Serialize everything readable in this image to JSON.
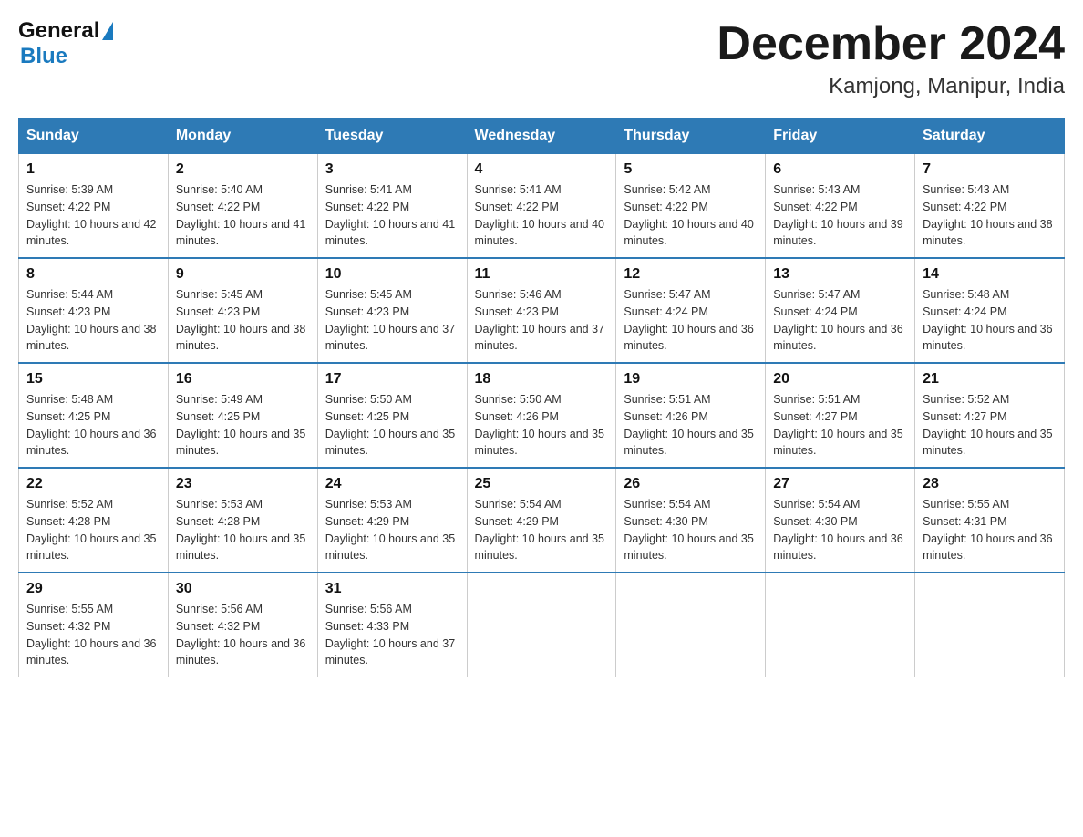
{
  "header": {
    "logo_text_general": "General",
    "logo_text_blue": "Blue",
    "month_title": "December 2024",
    "location": "Kamjong, Manipur, India"
  },
  "weekdays": [
    "Sunday",
    "Monday",
    "Tuesday",
    "Wednesday",
    "Thursday",
    "Friday",
    "Saturday"
  ],
  "weeks": [
    [
      {
        "day": "1",
        "sunrise": "Sunrise: 5:39 AM",
        "sunset": "Sunset: 4:22 PM",
        "daylight": "Daylight: 10 hours and 42 minutes."
      },
      {
        "day": "2",
        "sunrise": "Sunrise: 5:40 AM",
        "sunset": "Sunset: 4:22 PM",
        "daylight": "Daylight: 10 hours and 41 minutes."
      },
      {
        "day": "3",
        "sunrise": "Sunrise: 5:41 AM",
        "sunset": "Sunset: 4:22 PM",
        "daylight": "Daylight: 10 hours and 41 minutes."
      },
      {
        "day": "4",
        "sunrise": "Sunrise: 5:41 AM",
        "sunset": "Sunset: 4:22 PM",
        "daylight": "Daylight: 10 hours and 40 minutes."
      },
      {
        "day": "5",
        "sunrise": "Sunrise: 5:42 AM",
        "sunset": "Sunset: 4:22 PM",
        "daylight": "Daylight: 10 hours and 40 minutes."
      },
      {
        "day": "6",
        "sunrise": "Sunrise: 5:43 AM",
        "sunset": "Sunset: 4:22 PM",
        "daylight": "Daylight: 10 hours and 39 minutes."
      },
      {
        "day": "7",
        "sunrise": "Sunrise: 5:43 AM",
        "sunset": "Sunset: 4:22 PM",
        "daylight": "Daylight: 10 hours and 38 minutes."
      }
    ],
    [
      {
        "day": "8",
        "sunrise": "Sunrise: 5:44 AM",
        "sunset": "Sunset: 4:23 PM",
        "daylight": "Daylight: 10 hours and 38 minutes."
      },
      {
        "day": "9",
        "sunrise": "Sunrise: 5:45 AM",
        "sunset": "Sunset: 4:23 PM",
        "daylight": "Daylight: 10 hours and 38 minutes."
      },
      {
        "day": "10",
        "sunrise": "Sunrise: 5:45 AM",
        "sunset": "Sunset: 4:23 PM",
        "daylight": "Daylight: 10 hours and 37 minutes."
      },
      {
        "day": "11",
        "sunrise": "Sunrise: 5:46 AM",
        "sunset": "Sunset: 4:23 PM",
        "daylight": "Daylight: 10 hours and 37 minutes."
      },
      {
        "day": "12",
        "sunrise": "Sunrise: 5:47 AM",
        "sunset": "Sunset: 4:24 PM",
        "daylight": "Daylight: 10 hours and 36 minutes."
      },
      {
        "day": "13",
        "sunrise": "Sunrise: 5:47 AM",
        "sunset": "Sunset: 4:24 PM",
        "daylight": "Daylight: 10 hours and 36 minutes."
      },
      {
        "day": "14",
        "sunrise": "Sunrise: 5:48 AM",
        "sunset": "Sunset: 4:24 PM",
        "daylight": "Daylight: 10 hours and 36 minutes."
      }
    ],
    [
      {
        "day": "15",
        "sunrise": "Sunrise: 5:48 AM",
        "sunset": "Sunset: 4:25 PM",
        "daylight": "Daylight: 10 hours and 36 minutes."
      },
      {
        "day": "16",
        "sunrise": "Sunrise: 5:49 AM",
        "sunset": "Sunset: 4:25 PM",
        "daylight": "Daylight: 10 hours and 35 minutes."
      },
      {
        "day": "17",
        "sunrise": "Sunrise: 5:50 AM",
        "sunset": "Sunset: 4:25 PM",
        "daylight": "Daylight: 10 hours and 35 minutes."
      },
      {
        "day": "18",
        "sunrise": "Sunrise: 5:50 AM",
        "sunset": "Sunset: 4:26 PM",
        "daylight": "Daylight: 10 hours and 35 minutes."
      },
      {
        "day": "19",
        "sunrise": "Sunrise: 5:51 AM",
        "sunset": "Sunset: 4:26 PM",
        "daylight": "Daylight: 10 hours and 35 minutes."
      },
      {
        "day": "20",
        "sunrise": "Sunrise: 5:51 AM",
        "sunset": "Sunset: 4:27 PM",
        "daylight": "Daylight: 10 hours and 35 minutes."
      },
      {
        "day": "21",
        "sunrise": "Sunrise: 5:52 AM",
        "sunset": "Sunset: 4:27 PM",
        "daylight": "Daylight: 10 hours and 35 minutes."
      }
    ],
    [
      {
        "day": "22",
        "sunrise": "Sunrise: 5:52 AM",
        "sunset": "Sunset: 4:28 PM",
        "daylight": "Daylight: 10 hours and 35 minutes."
      },
      {
        "day": "23",
        "sunrise": "Sunrise: 5:53 AM",
        "sunset": "Sunset: 4:28 PM",
        "daylight": "Daylight: 10 hours and 35 minutes."
      },
      {
        "day": "24",
        "sunrise": "Sunrise: 5:53 AM",
        "sunset": "Sunset: 4:29 PM",
        "daylight": "Daylight: 10 hours and 35 minutes."
      },
      {
        "day": "25",
        "sunrise": "Sunrise: 5:54 AM",
        "sunset": "Sunset: 4:29 PM",
        "daylight": "Daylight: 10 hours and 35 minutes."
      },
      {
        "day": "26",
        "sunrise": "Sunrise: 5:54 AM",
        "sunset": "Sunset: 4:30 PM",
        "daylight": "Daylight: 10 hours and 35 minutes."
      },
      {
        "day": "27",
        "sunrise": "Sunrise: 5:54 AM",
        "sunset": "Sunset: 4:30 PM",
        "daylight": "Daylight: 10 hours and 36 minutes."
      },
      {
        "day": "28",
        "sunrise": "Sunrise: 5:55 AM",
        "sunset": "Sunset: 4:31 PM",
        "daylight": "Daylight: 10 hours and 36 minutes."
      }
    ],
    [
      {
        "day": "29",
        "sunrise": "Sunrise: 5:55 AM",
        "sunset": "Sunset: 4:32 PM",
        "daylight": "Daylight: 10 hours and 36 minutes."
      },
      {
        "day": "30",
        "sunrise": "Sunrise: 5:56 AM",
        "sunset": "Sunset: 4:32 PM",
        "daylight": "Daylight: 10 hours and 36 minutes."
      },
      {
        "day": "31",
        "sunrise": "Sunrise: 5:56 AM",
        "sunset": "Sunset: 4:33 PM",
        "daylight": "Daylight: 10 hours and 37 minutes."
      },
      null,
      null,
      null,
      null
    ]
  ]
}
